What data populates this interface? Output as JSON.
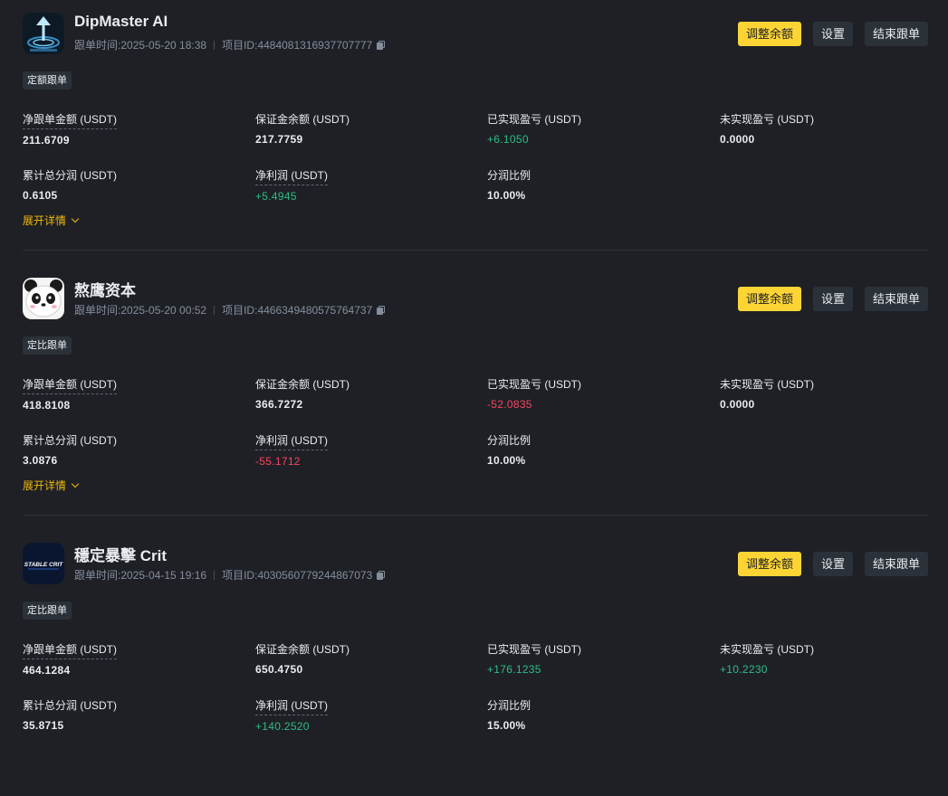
{
  "labels": {
    "follow_time_prefix": "跟单时间: ",
    "project_id_prefix": "项目ID: ",
    "adjust_button": "调整余额",
    "settings_button": "设置",
    "end_button": "结束跟单",
    "net_amount": "净跟单金额 (USDT)",
    "margin_balance": "保证金余额 (USDT)",
    "realized_pnl": "已实现盈亏 (USDT)",
    "unrealized_pnl": "未实现盈亏 (USDT)",
    "total_profit_share": "累计总分润 (USDT)",
    "net_profit": "净利润 (USDT)",
    "share_ratio": "分润比例",
    "expand_details": "展开详情"
  },
  "colors": {
    "accent": "#fcd535",
    "positive": "#2ebd85",
    "negative": "#f6465d",
    "background": "#1e2026"
  },
  "cards": [
    {
      "name": "DipMaster AI",
      "avatar_icon": "dipmaster-logo-icon",
      "follow_time": "2025-05-20 18:38",
      "project_id": "4484081316937707777",
      "badge": "定额跟单",
      "net_amount": "211.6709",
      "margin_balance": "217.7759",
      "realized_pnl": "+6.1050",
      "realized_pnl_sign": "pos",
      "unrealized_pnl": "0.0000",
      "unrealized_pnl_sign": "neutral",
      "total_profit_share": "0.6105",
      "net_profit": "+5.4945",
      "net_profit_sign": "pos",
      "share_ratio": "10.00%"
    },
    {
      "name": "熬鹰资本",
      "avatar_icon": "panda-avatar-icon",
      "follow_time": "2025-05-20 00:52",
      "project_id": "4466349480575764737",
      "badge": "定比跟单",
      "net_amount": "418.8108",
      "margin_balance": "366.7272",
      "realized_pnl": "-52.0835",
      "realized_pnl_sign": "neg",
      "unrealized_pnl": "0.0000",
      "unrealized_pnl_sign": "neutral",
      "total_profit_share": "3.0876",
      "net_profit": "-55.1712",
      "net_profit_sign": "neg",
      "share_ratio": "10.00%"
    },
    {
      "name": "穩定暴擊 Crit",
      "avatar_icon": "stable-crit-logo-icon",
      "avatar_text": "STABLE CRIT",
      "follow_time": "2025-04-15 19:16",
      "project_id": "4030560779244867073",
      "badge": "定比跟单",
      "net_amount": "464.1284",
      "margin_balance": "650.4750",
      "realized_pnl": "+176.1235",
      "realized_pnl_sign": "pos",
      "unrealized_pnl": "+10.2230",
      "unrealized_pnl_sign": "pos",
      "total_profit_share": "35.8715",
      "net_profit": "+140.2520",
      "net_profit_sign": "pos",
      "share_ratio": "15.00%"
    }
  ]
}
